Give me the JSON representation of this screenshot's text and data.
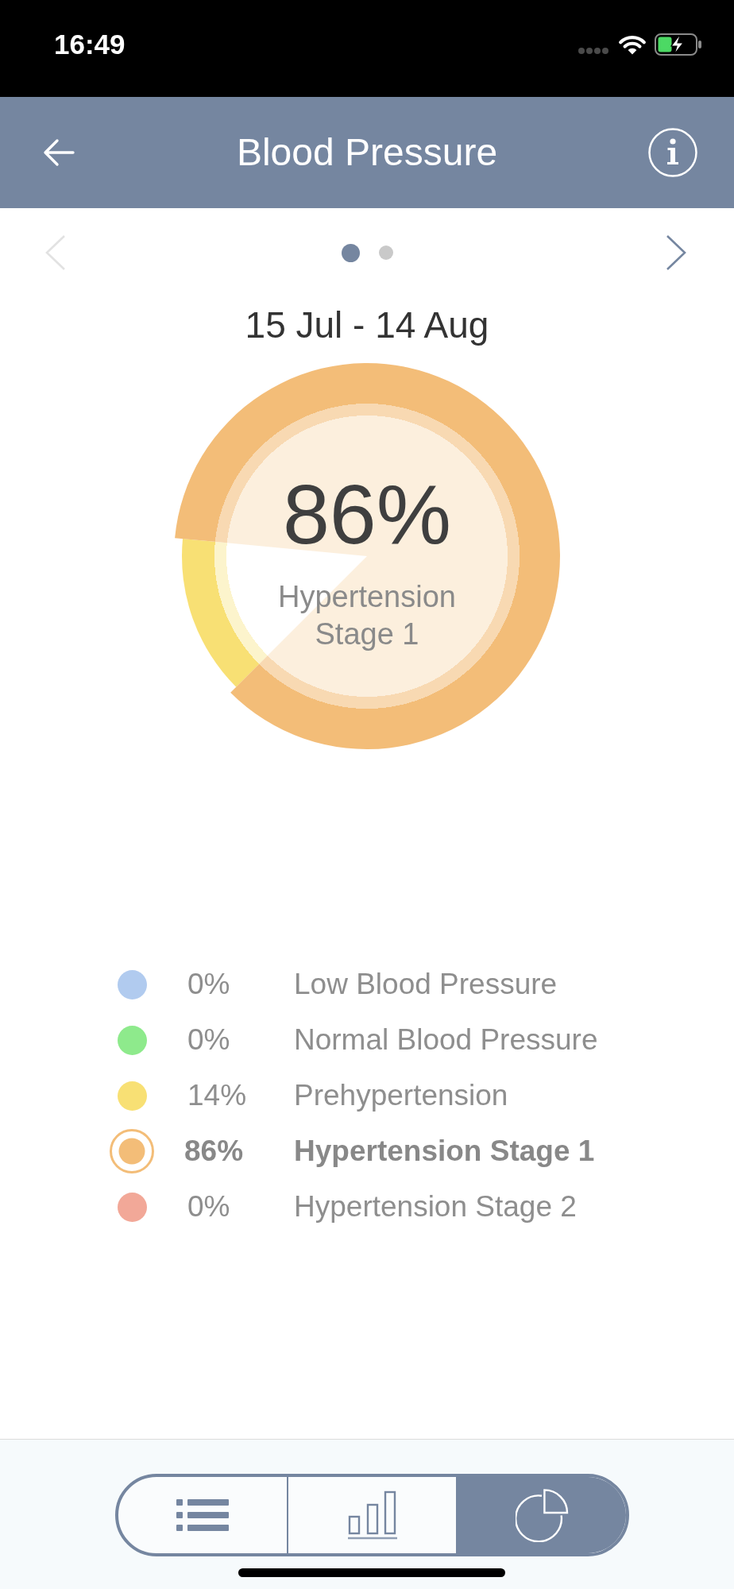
{
  "status_bar": {
    "time": "16:49"
  },
  "header": {
    "title": "Blood Pressure"
  },
  "pager": {
    "previous": {
      "disabled": true
    },
    "next": {
      "disabled": false
    },
    "pages": [
      {
        "selected": true
      },
      {
        "selected": false
      }
    ]
  },
  "period": "15 Jul - 14 Aug",
  "summary": {
    "value": "86%",
    "label": "Hypertension Stage 1",
    "chart_data": {
      "type": "pie",
      "values": [
        0,
        0,
        14,
        86,
        0
      ]
    }
  },
  "legend": [
    {
      "color": "#b1cbef",
      "percent": "0%",
      "label": "Low Blood Pressure",
      "selected": false
    },
    {
      "color": "#8eea8c",
      "percent": "0%",
      "label": "Normal Blood Pressure",
      "selected": false
    },
    {
      "color": "#f8e074",
      "percent": "14%",
      "label": "Prehypertension",
      "selected": false
    },
    {
      "color": "#f3bd78",
      "percent": "86%",
      "label": "Hypertension Stage 1",
      "selected": true
    },
    {
      "color": "#f2a898",
      "percent": "0%",
      "label": "Hypertension Stage 2",
      "selected": false
    }
  ],
  "view_tabs": [
    {
      "kind": "list",
      "selected": false
    },
    {
      "kind": "bars",
      "selected": false
    },
    {
      "kind": "pie",
      "selected": true
    }
  ]
}
